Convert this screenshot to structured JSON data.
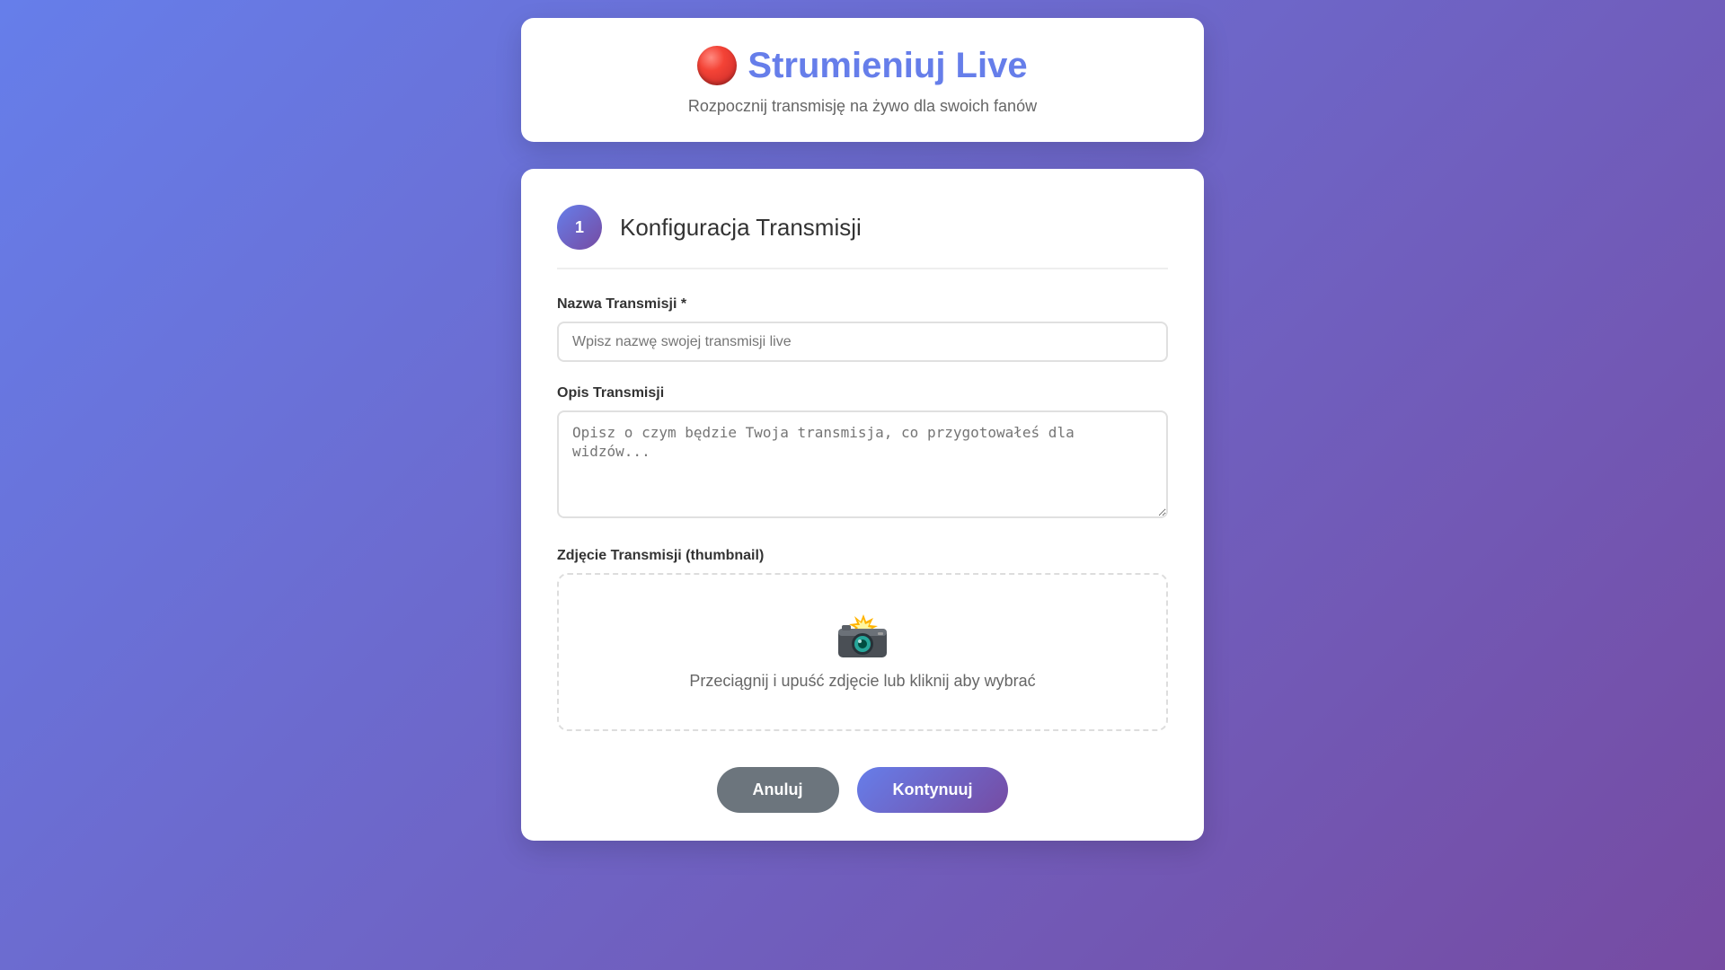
{
  "header": {
    "live_icon": "red-circle-icon",
    "title": "Strumieniuj Live",
    "subtitle": "Rozpocznij transmisję na żywo dla swoich fanów"
  },
  "step": {
    "number": "1",
    "title": "Konfiguracja Transmisji"
  },
  "form": {
    "name_label": "Nazwa Transmisji *",
    "name_placeholder": "Wpisz nazwę swojej transmisji live",
    "name_value": "",
    "description_label": "Opis Transmisji",
    "description_placeholder": "Opisz o czym będzie Twoja transmisja, co przygotowałeś dla widzów...",
    "description_value": "",
    "thumbnail_label": "Zdjęcie Transmisji (thumbnail)",
    "thumbnail_icon": "camera-flash-icon",
    "thumbnail_hint": "Przeciągnij i upuść zdjęcie lub kliknij aby wybrać"
  },
  "buttons": {
    "cancel_label": "Anuluj",
    "continue_label": "Kontynuuj"
  },
  "colors": {
    "accent": "#667eea",
    "accent_end": "#764ba2",
    "cancel": "#6c757d"
  }
}
